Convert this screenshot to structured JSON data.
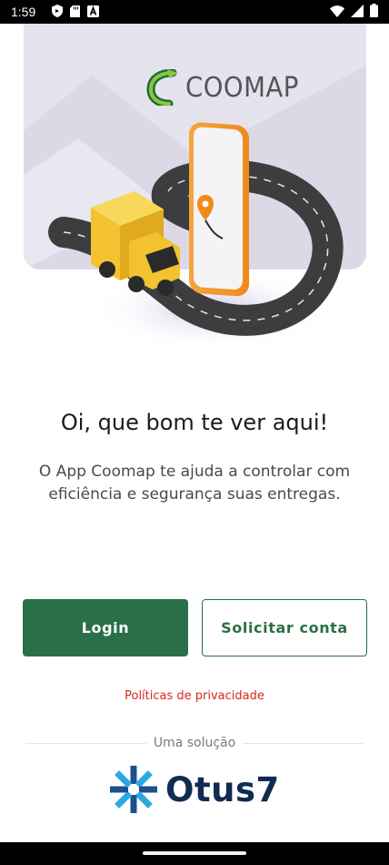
{
  "status_bar": {
    "time": "1:59",
    "left_icons": [
      "shield-icon",
      "sd-card-icon",
      "app-a-icon"
    ],
    "right_icons": [
      "wifi-icon",
      "signal-icon",
      "battery-icon"
    ]
  },
  "brand": {
    "logo_text": "COOMAP",
    "accent_color": "#2b6f48",
    "hero_bg_color": "#e5e3ee"
  },
  "welcome": {
    "title": "Oi, que bom te ver aqui!",
    "subtitle": "O App Coomap te ajuda a controlar com eficiência e segurança suas entregas."
  },
  "actions": {
    "login_label": "Login",
    "request_account_label": "Solicitar conta"
  },
  "footer": {
    "privacy_label": "Políticas de privacidade",
    "privacy_color": "#d42a1c",
    "solution_label": "Uma solução",
    "partner_logo_text": "Otus7"
  }
}
